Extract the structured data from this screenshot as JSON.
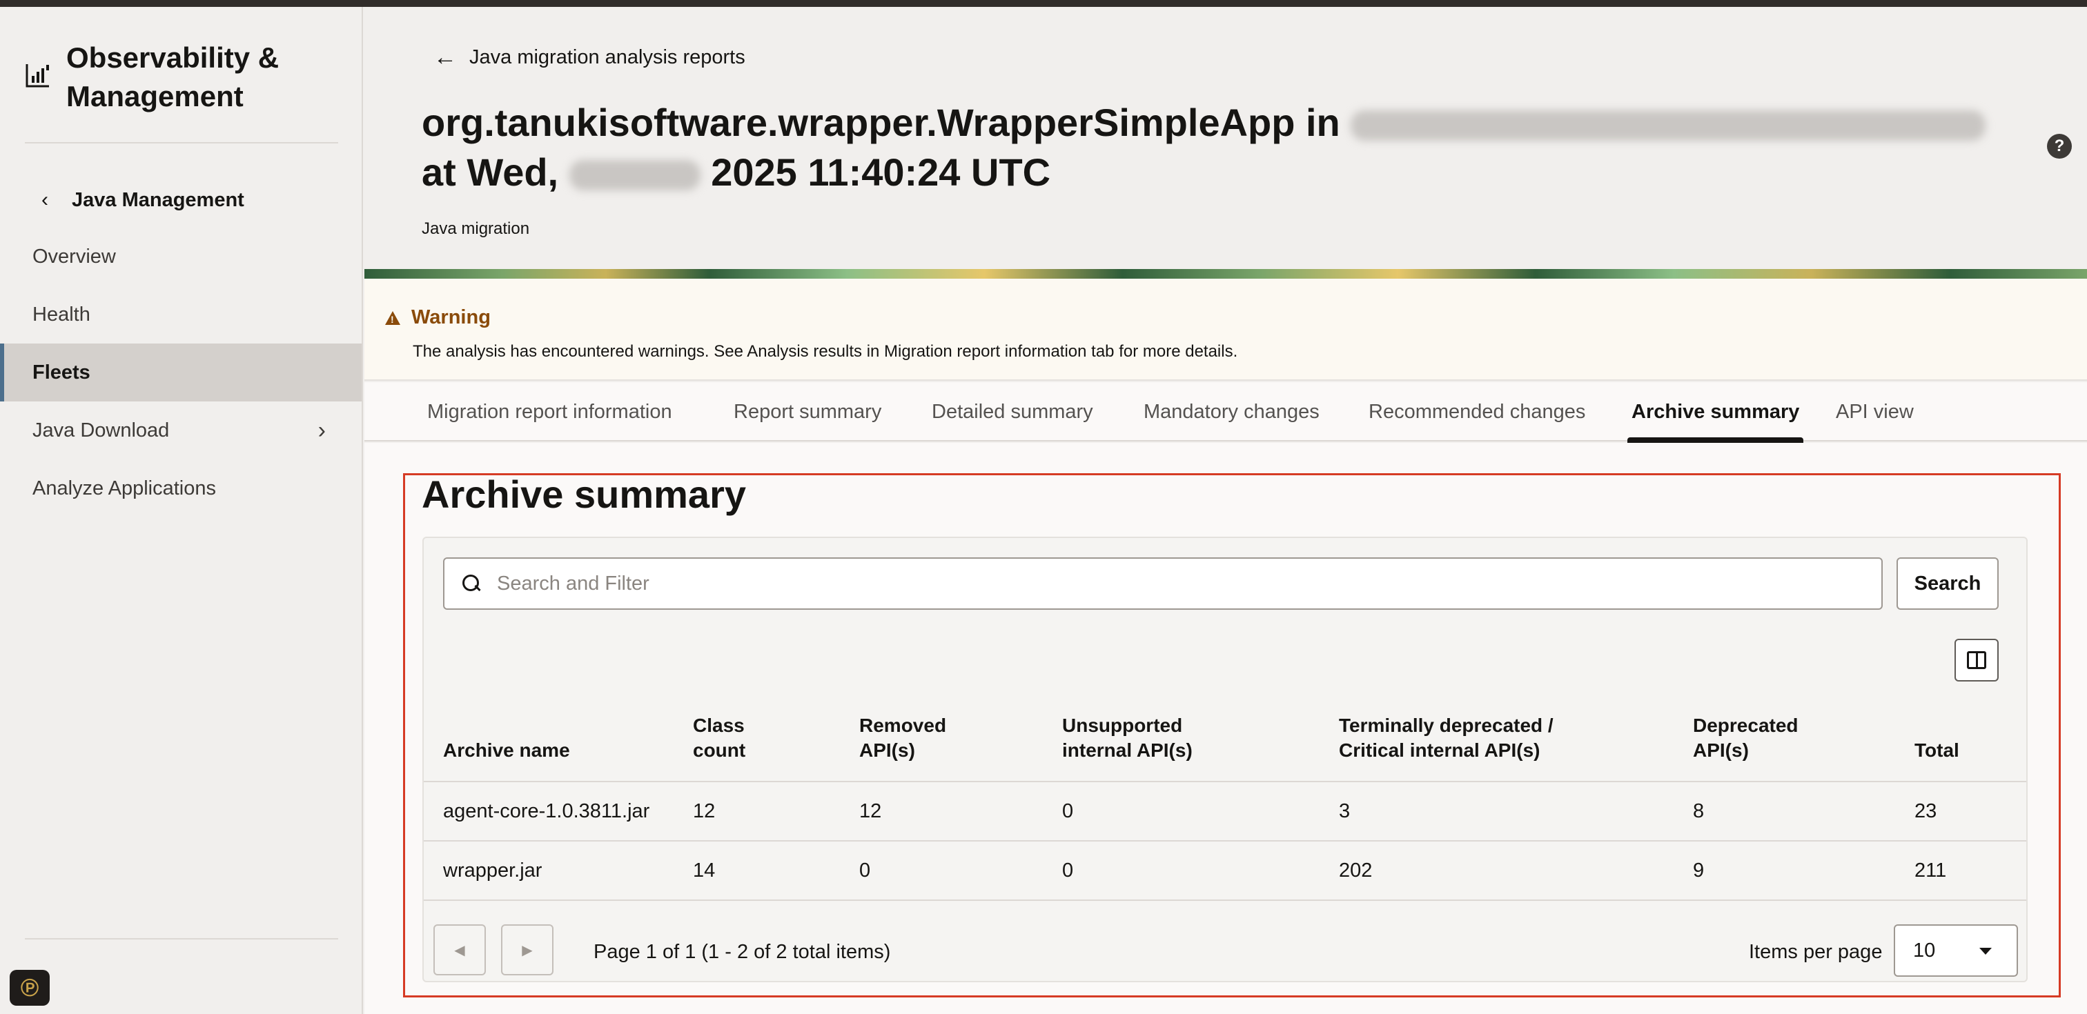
{
  "sidebar": {
    "brand_title": "Observability & Management",
    "back_label": "Java Management",
    "items": [
      {
        "label": "Overview"
      },
      {
        "label": "Health"
      },
      {
        "label": "Fleets"
      },
      {
        "label": "Java Download"
      },
      {
        "label": "Analyze Applications"
      }
    ],
    "active_item": "Fleets",
    "accent_color": "#4d6f8c"
  },
  "header": {
    "breadcrumb": "Java migration analysis reports",
    "title_part1": "org.tanukisoftware.wrapper.WrapperSimpleApp in",
    "title_part2_prefix": "at Wed,",
    "title_part2_suffix": "2025 11:40:24 UTC",
    "subtitle": "Java migration",
    "help_icon": "?"
  },
  "warning": {
    "title": "Warning",
    "message": "The analysis has encountered warnings. See Analysis results in Migration report information tab for more details.",
    "color": "#8a4b0a"
  },
  "tabs": [
    {
      "label": "Migration report information"
    },
    {
      "label": "Report summary"
    },
    {
      "label": "Detailed summary"
    },
    {
      "label": "Mandatory changes"
    },
    {
      "label": "Recommended changes"
    },
    {
      "label": "Archive summary"
    },
    {
      "label": "API view"
    }
  ],
  "active_tab": "Archive summary",
  "archive": {
    "title": "Archive summary",
    "search_placeholder": "Search and Filter",
    "search_button": "Search",
    "columns": [
      "Archive name",
      "Class count",
      "Removed API(s)",
      "Unsupported internal API(s)",
      "Terminally deprecated / Critical internal API(s)",
      "Deprecated API(s)",
      "Total"
    ],
    "rows": [
      [
        "agent-core-1.0.3811.jar",
        "12",
        "12",
        "0",
        "3",
        "8",
        "23"
      ],
      [
        "wrapper.jar",
        "14",
        "0",
        "0",
        "202",
        "9",
        "211"
      ]
    ],
    "pagination_text": "Page 1 of 1 (1 - 2 of 2 total items)",
    "items_per_page_label": "Items per page",
    "items_per_page_value": "10"
  },
  "highlight_color": "#d63b25"
}
